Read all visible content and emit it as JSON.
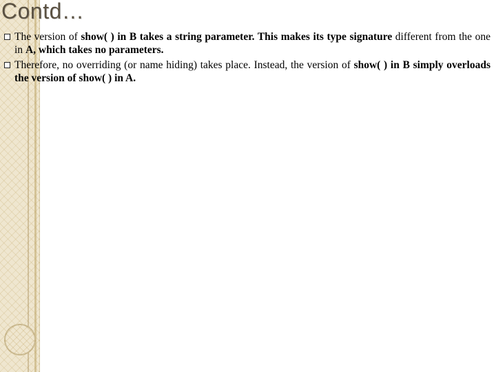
{
  "title": "Contd…",
  "bullets": [
    {
      "segments": [
        {
          "t": "The version of ",
          "b": false
        },
        {
          "t": "show( ) in B takes a string parameter. This makes its type signature ",
          "b": true
        },
        {
          "t": "different from the one in ",
          "b": false
        },
        {
          "t": "A, which takes no parameters.",
          "b": true
        }
      ]
    },
    {
      "segments": [
        {
          "t": "Therefore, no overriding (or name hiding) takes place. Instead, the version of ",
          "b": false
        },
        {
          "t": "show( ) in B simply overloads the version of show( ) in A.",
          "b": true
        }
      ]
    }
  ]
}
